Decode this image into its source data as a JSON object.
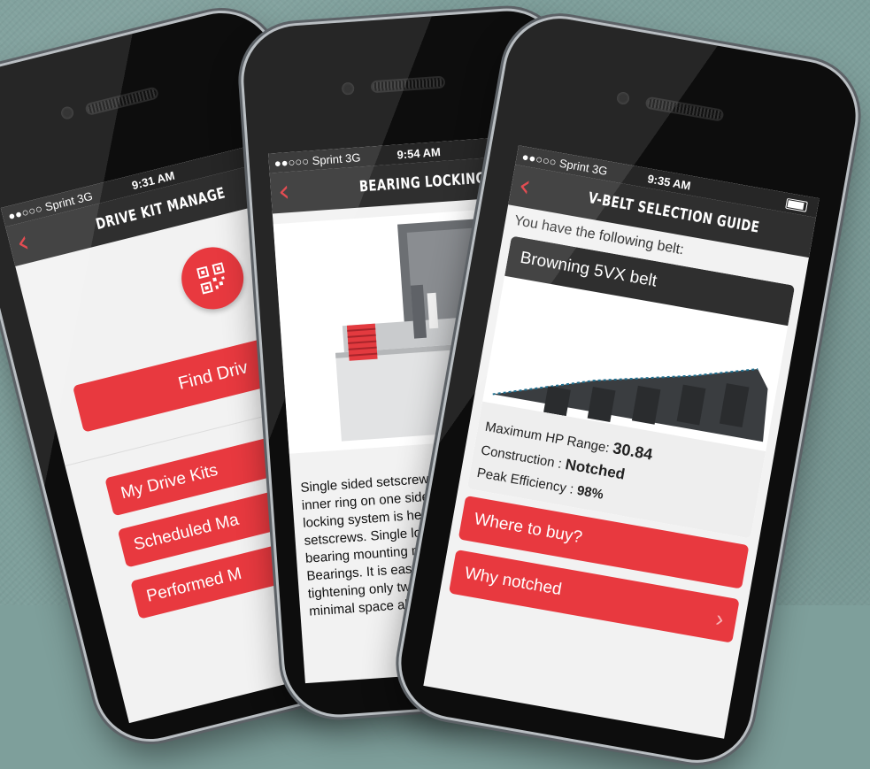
{
  "phones": {
    "left": {
      "carrier": "●●○○○ Sprint  3G",
      "time": "9:31 AM",
      "title": "DRIVE KIT MANAGE",
      "back": "‹",
      "qr_icon": "qr-code-icon",
      "find_label": "Find Driv",
      "menu": [
        "My Drive Kits",
        "Scheduled Ma",
        "Performed M"
      ]
    },
    "middle": {
      "carrier": "●●○○○ Sprint  3G",
      "time": "9:54 AM",
      "title": "BEARING LOCKING STY",
      "back": "‹",
      "body_lines": [
        "Single sided setscrew",
        "inner ring on one side",
        "locking system is hel",
        "setscrews. Single lo",
        "bearing mounting m",
        "Bearings. It is easy",
        "tightening only two",
        "minimal space ale"
      ]
    },
    "right": {
      "carrier": "●●○○○ Sprint  3G",
      "time": "9:35 AM",
      "title": "V-BELT SELECTION GUIDE",
      "back": "‹",
      "intro": "You have the following belt:",
      "belt_name": "Browning 5VX belt",
      "specs": [
        {
          "label": "Maximum HP Range:",
          "value": "30.84"
        },
        {
          "label": "Construction :",
          "value": "Notched"
        },
        {
          "label": "Peak Efficiency :",
          "value": "98%"
        }
      ],
      "buttons": [
        "Where to buy?",
        "Why notched"
      ],
      "chevron": "›"
    }
  },
  "colors": {
    "accent": "#e8393f",
    "bar": "#2f2f2f",
    "background": "#7e9f9b"
  }
}
